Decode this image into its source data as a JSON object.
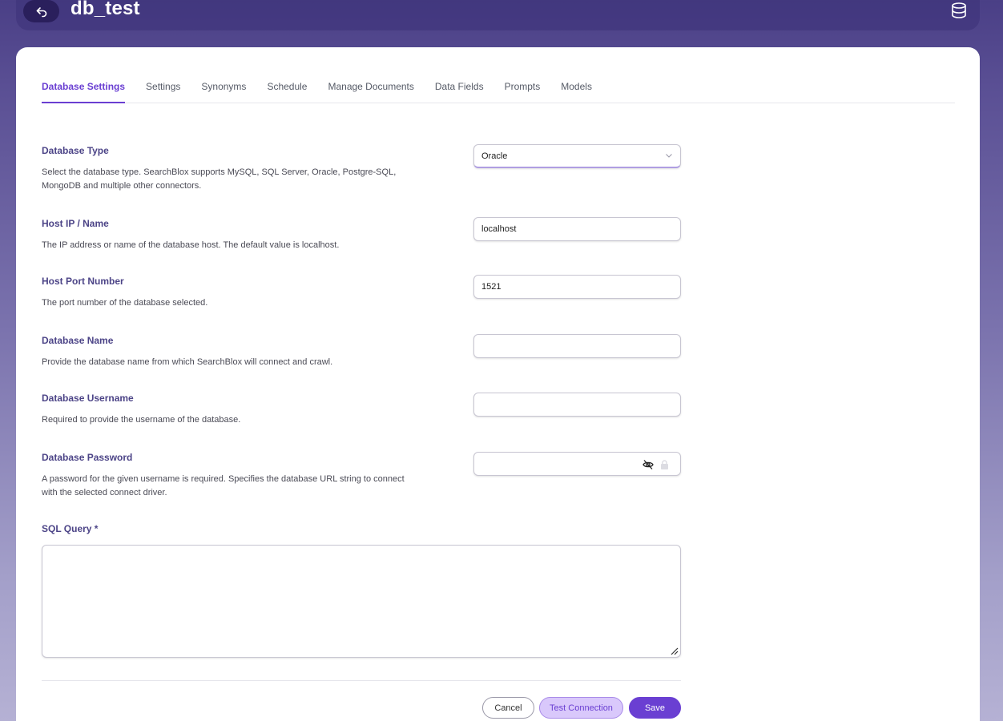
{
  "header": {
    "title": "db_test"
  },
  "tabs": [
    {
      "label": "Database Settings"
    },
    {
      "label": "Settings"
    },
    {
      "label": "Synonyms"
    },
    {
      "label": "Schedule"
    },
    {
      "label": "Manage Documents"
    },
    {
      "label": "Data Fields"
    },
    {
      "label": "Prompts"
    },
    {
      "label": "Models"
    }
  ],
  "form": {
    "database_type": {
      "label": "Database Type",
      "desc": "Select the database type. SearchBlox supports MySQL, SQL Server, Oracle, Postgre-SQL, MongoDB and multiple other connectors.",
      "value": "Oracle"
    },
    "host": {
      "label": "Host IP / Name",
      "desc": "The IP address or name of the database host. The default value is localhost.",
      "value": "localhost"
    },
    "port": {
      "label": "Host Port Number",
      "desc": "The port number of the database selected.",
      "value": "1521"
    },
    "db_name": {
      "label": "Database Name",
      "desc": "Provide the database name from which SearchBlox will connect and crawl.",
      "value": ""
    },
    "username": {
      "label": "Database Username",
      "desc": "Required to provide the username of the database.",
      "value": ""
    },
    "password": {
      "label": "Database Password",
      "desc": "A password for the given username is required. Specifies the database URL string to connect with the selected connect driver.",
      "value": ""
    },
    "sql_query": {
      "label": "SQL Query *",
      "value": ""
    }
  },
  "buttons": {
    "cancel": "Cancel",
    "test": "Test Connection",
    "save": "Save"
  },
  "colors": {
    "accent": "#6a3fd2",
    "label": "#4c4487",
    "header_bg": "#4a3f86"
  }
}
